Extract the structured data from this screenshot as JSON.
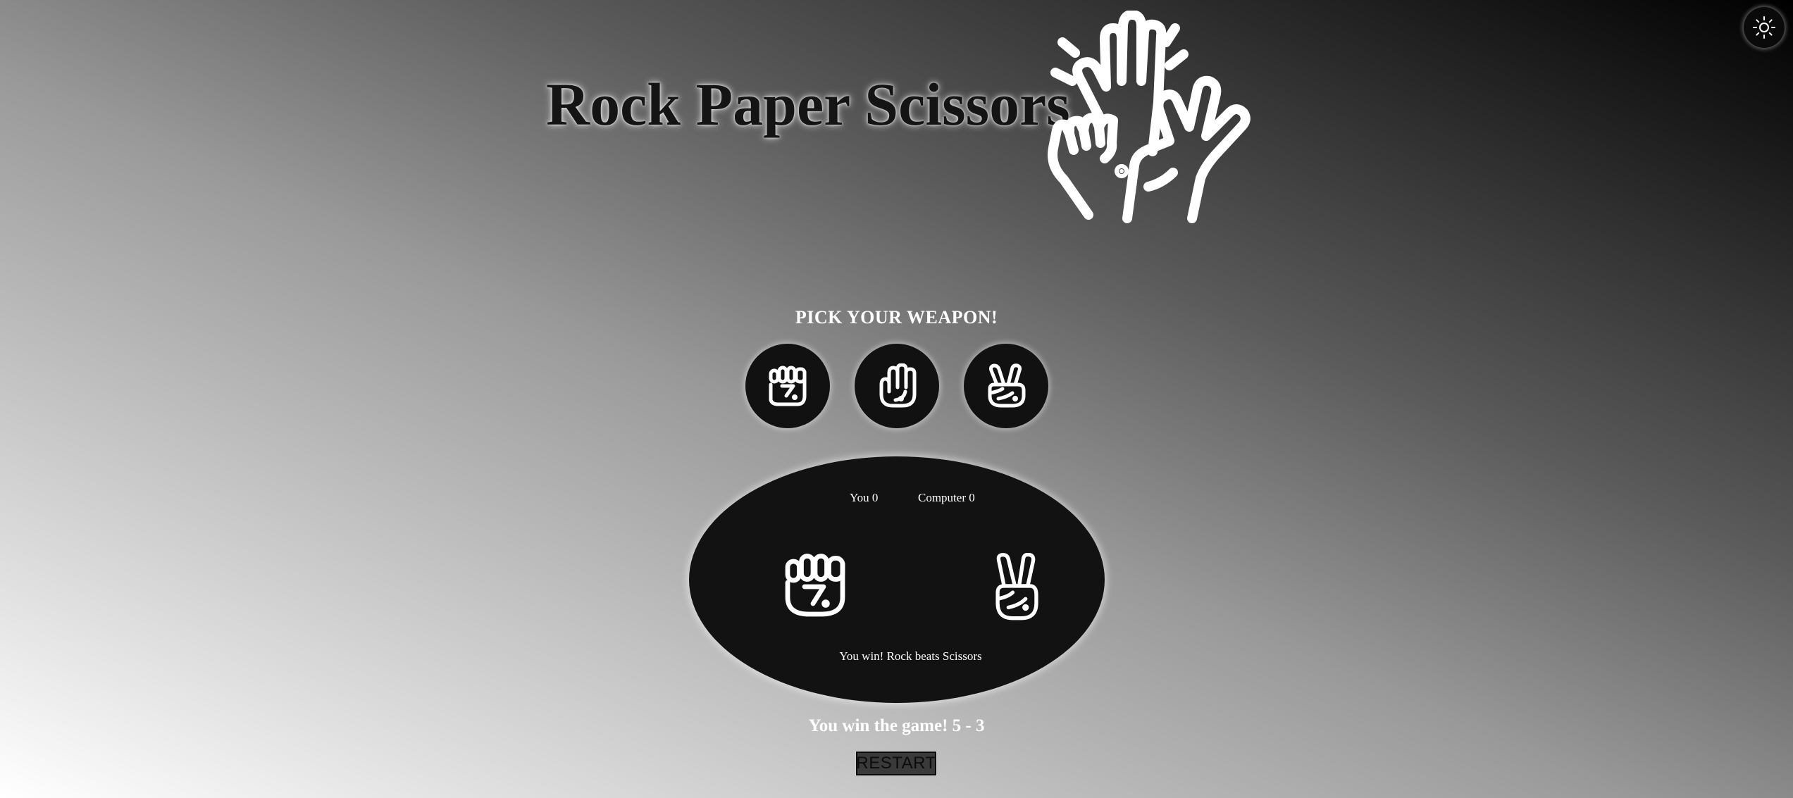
{
  "header": {
    "title": "Rock Paper Scissors",
    "hero_icon": "hands-icon"
  },
  "theme_toggle": {
    "icon": "sun-icon"
  },
  "game": {
    "prompt": "PICK YOUR WEAPON!",
    "weapons": [
      {
        "name": "rock",
        "icon": "fist-icon"
      },
      {
        "name": "paper",
        "icon": "open-hand-icon"
      },
      {
        "name": "scissors",
        "icon": "peace-hand-icon"
      }
    ],
    "score": {
      "player_label": "You",
      "player_value": "0",
      "computer_label": "Computer",
      "computer_value": "0"
    },
    "player_choice_icon": "fist-icon",
    "computer_choice_icon": "peace-hand-icon",
    "round_result": "You win! Rock beats Scissors",
    "final_result": "You win the game! 5 - 3",
    "restart_label": "RESTART"
  }
}
